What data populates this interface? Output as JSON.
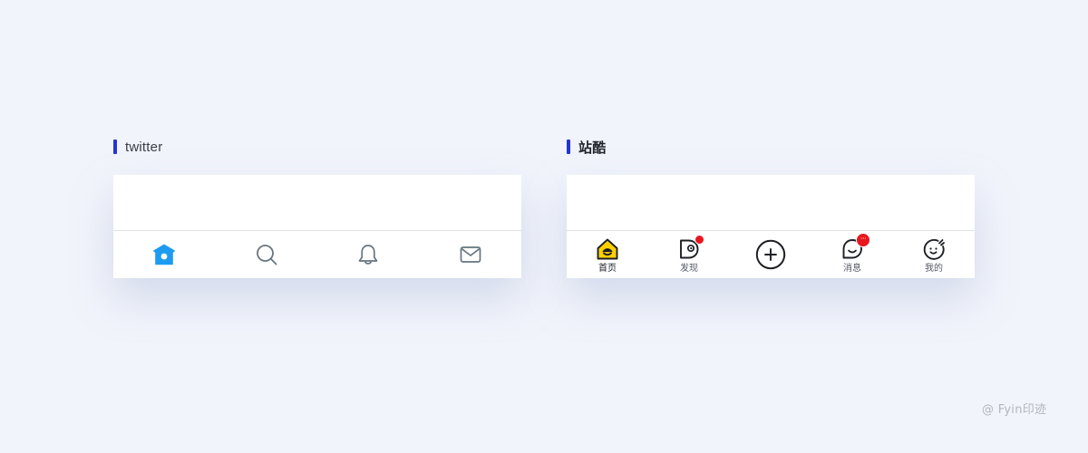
{
  "twitter_panel": {
    "label": "twitter",
    "accent_color": "#2334d6",
    "active_color": "#1d9bf0",
    "inactive_color": "#66757f",
    "tabs": [
      {
        "icon": "home-icon",
        "active": true
      },
      {
        "icon": "search-icon",
        "active": false
      },
      {
        "icon": "bell-icon",
        "active": false
      },
      {
        "icon": "mail-icon",
        "active": false
      }
    ]
  },
  "zcool_panel": {
    "label": "站酷",
    "accent_color": "#2334d6",
    "active_fill": "#ffd000",
    "badge_color": "#e8161e",
    "tabs": [
      {
        "icon": "home-icon",
        "label": "首页",
        "active": true
      },
      {
        "icon": "discover-icon",
        "label": "发现",
        "badge": "dot"
      },
      {
        "icon": "add-icon",
        "label": ""
      },
      {
        "icon": "message-icon",
        "label": "消息",
        "badge": "more"
      },
      {
        "icon": "profile-icon",
        "label": "我的"
      }
    ],
    "message_badge_text": "···"
  },
  "watermark": "@ Fyin印迹"
}
